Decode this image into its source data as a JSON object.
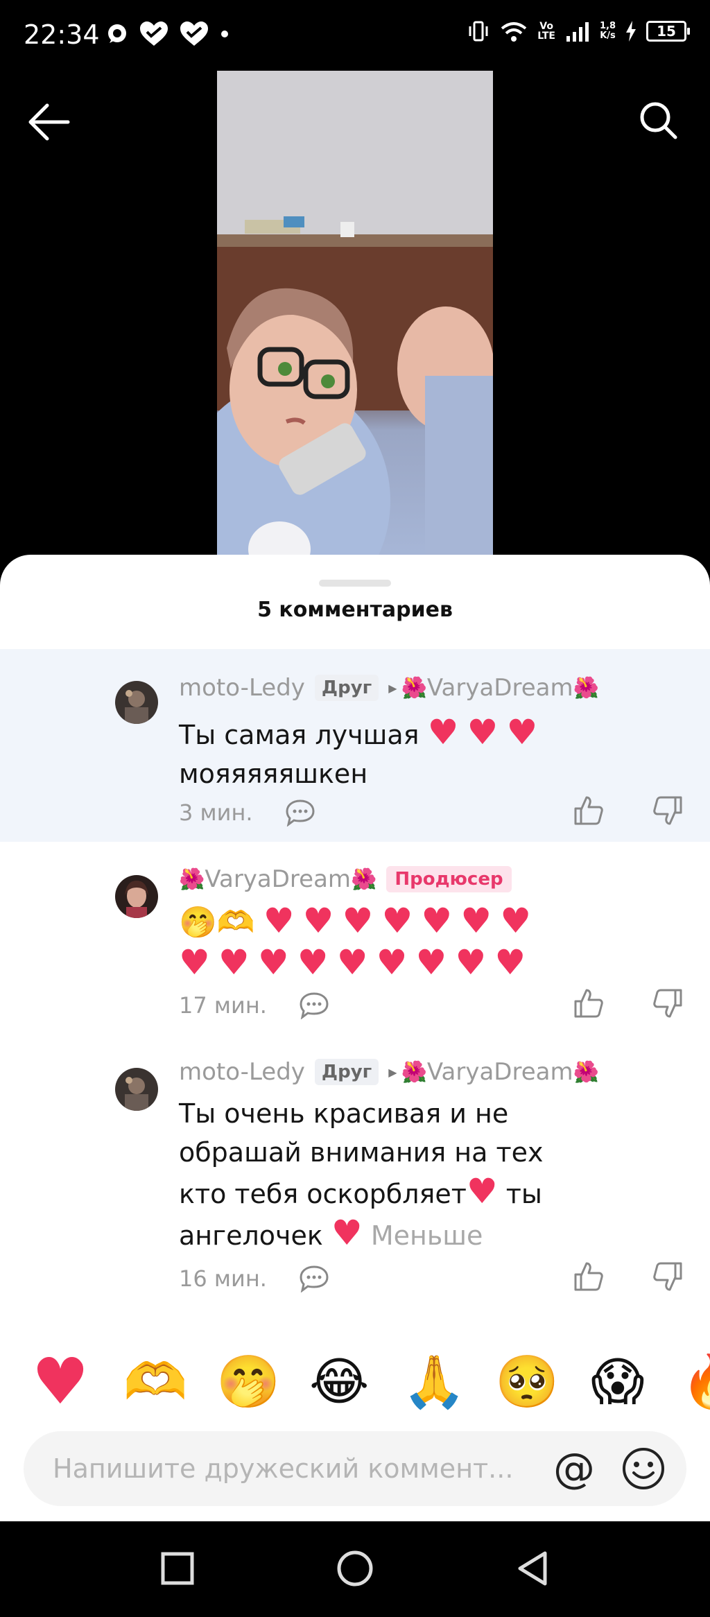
{
  "status_bar": {
    "time": "22:34",
    "lte_top": "Vo",
    "lte_bottom": "LTE",
    "speed_top": "1,8",
    "speed_bottom": "K/s",
    "battery": "15"
  },
  "sheet": {
    "title": "5 комментариев"
  },
  "comments": [
    {
      "author": "moto-Ledy",
      "badge": "Друг",
      "reply_to": "VaryaDream",
      "text_line1": "Ты самая лучшая",
      "text_line2": "мояяяяяшкен",
      "time": "3 мин."
    },
    {
      "author": "VaryaDream",
      "badge": "Продюсер",
      "time": "17 мин."
    },
    {
      "author": "moto-Ledy",
      "badge": "Друг",
      "reply_to": "VaryaDream",
      "text_line1": "Ты очень красивая и не",
      "text_line2": "обрашай внимания на тех",
      "text_line3a": "кто тебя оскорбляет",
      "text_line3b": "ты",
      "text_line4": "ангелочек",
      "less": "Меньше",
      "time": "16 мин."
    }
  ],
  "input": {
    "placeholder": "Напишите дружеский коммент...",
    "at": "@"
  },
  "colors": {
    "accent_pink": "#f0335e",
    "producer_badge": "#e8386b",
    "highlight_bg": "#f1f5fb"
  },
  "icons": [
    "back-arrow-icon",
    "search-icon",
    "reply-icon",
    "thumbs-up-icon",
    "thumbs-down-icon",
    "emoji-icon",
    "square-nav-icon",
    "circle-nav-icon",
    "triangle-nav-icon"
  ]
}
